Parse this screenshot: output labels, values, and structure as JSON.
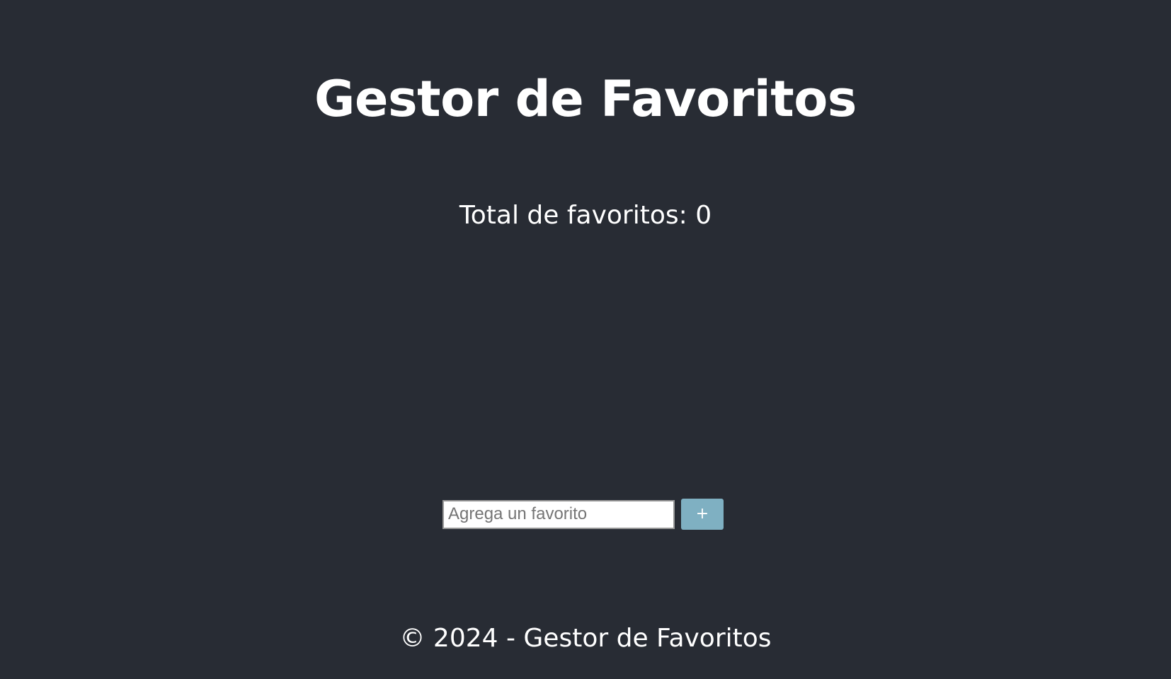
{
  "header": {
    "title": "Gestor de Favoritos"
  },
  "summary": {
    "total_text": "Total de favoritos: 0"
  },
  "form": {
    "input_value": "",
    "input_placeholder": "Agrega un favorito",
    "add_label": "+"
  },
  "footer": {
    "text": "© 2024 - Gestor de Favoritos"
  },
  "colors": {
    "background": "#282c34",
    "text": "#ffffff",
    "button": "#7fb0c2"
  }
}
